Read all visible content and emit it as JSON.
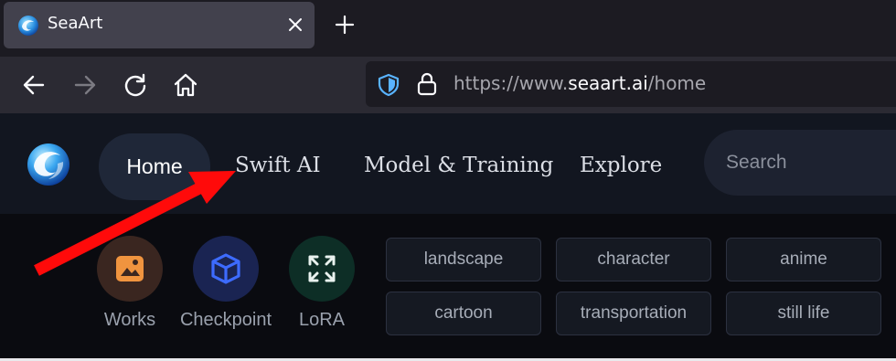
{
  "browser": {
    "tab": {
      "title": "SeaArt"
    },
    "url": {
      "scheme": "https://www.",
      "domain": "seaart.ai",
      "path": "/home"
    }
  },
  "site": {
    "nav": {
      "home": "Home",
      "swift_ai": "Swift AI",
      "model_training": "Model & Training",
      "explore": "Explore"
    },
    "search": {
      "placeholder": "Search"
    },
    "categories": [
      {
        "label": "Works",
        "icon": "image-icon",
        "color": "#f0943f",
        "bg": "#3a2620"
      },
      {
        "label": "Checkpoint",
        "icon": "cube-icon",
        "color": "#3d6bff",
        "bg": "#1a2452"
      },
      {
        "label": "LoRA",
        "icon": "expand-icon",
        "color": "#e8f1ee",
        "bg": "#0d2e26"
      }
    ],
    "tags": [
      "landscape",
      "character",
      "anime",
      "cartoon",
      "transportation",
      "still life"
    ]
  },
  "annotation": {
    "arrow_color": "#ff0a0a"
  }
}
